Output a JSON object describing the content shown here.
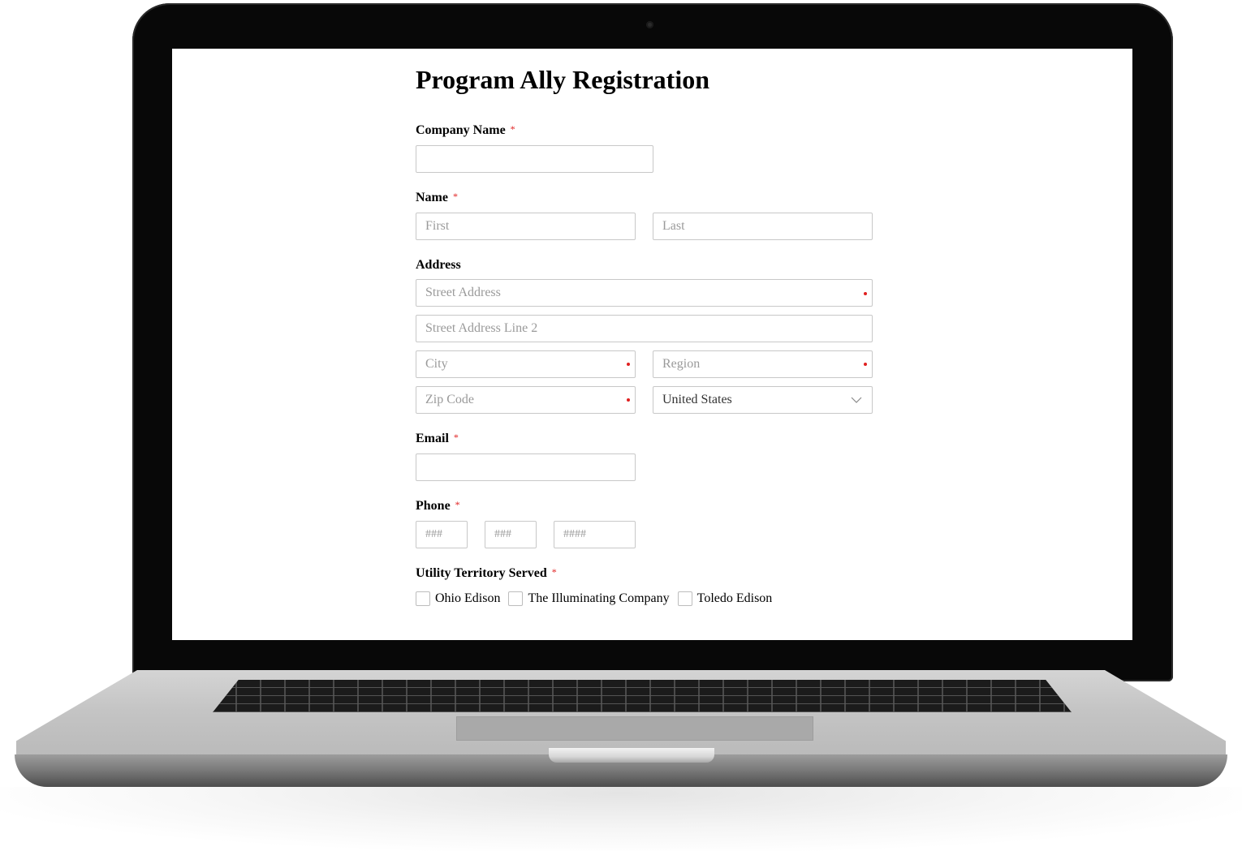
{
  "form": {
    "title": "Program Ally Registration",
    "required_mark": "*",
    "company": {
      "label": "Company Name",
      "value": ""
    },
    "name": {
      "label": "Name",
      "first_placeholder": "First",
      "last_placeholder": "Last"
    },
    "address": {
      "label": "Address",
      "street_placeholder": "Street Address",
      "street2_placeholder": "Street Address Line 2",
      "city_placeholder": "City",
      "region_placeholder": "Region",
      "zip_placeholder": "Zip Code",
      "country_value": "United States"
    },
    "email": {
      "label": "Email",
      "value": ""
    },
    "phone": {
      "label": "Phone",
      "area_placeholder": "###",
      "prefix_placeholder": "###",
      "line_placeholder": "####"
    },
    "utility": {
      "label": "Utility Territory Served",
      "options": [
        "Ohio Edison",
        "The Illuminating Company",
        "Toledo Edison"
      ]
    }
  },
  "colors": {
    "required": "#e02020",
    "laptop_bezel": "#080808",
    "laptop_body": "#c4c4c4"
  },
  "icons": {
    "country_select": "chevron-down-icon"
  }
}
